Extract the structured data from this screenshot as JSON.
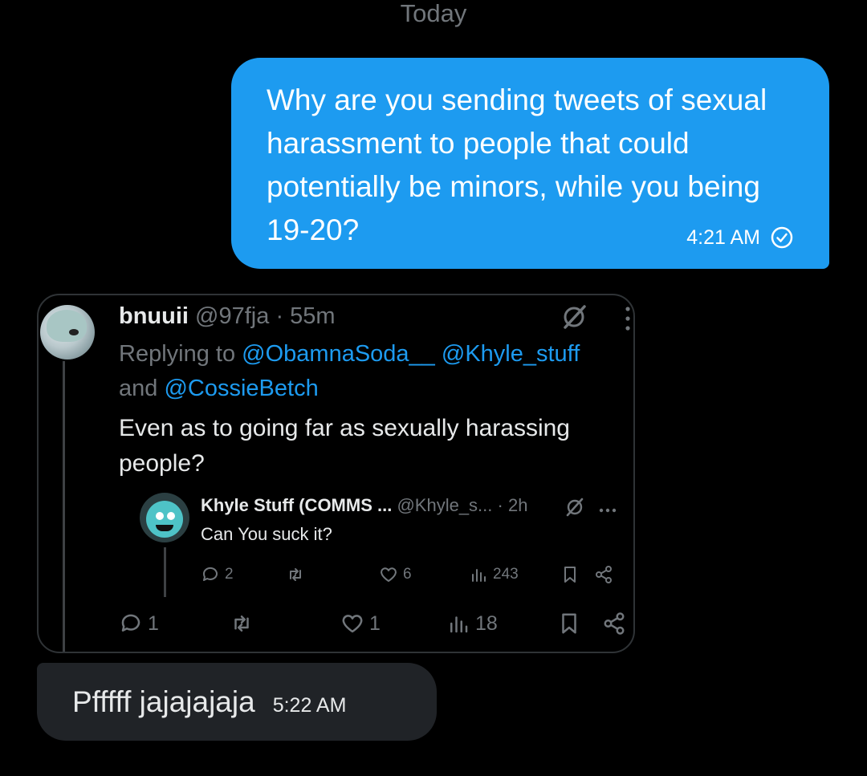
{
  "day_separator": "Today",
  "outgoing_message": {
    "text": "Why are you sending tweets of sexual harassment to people that could potentially be minors, while you being 19-20?",
    "time": "4:21 AM",
    "status_icon": "check-circle-icon"
  },
  "quoted_tweet": {
    "author_name": "bnuuii",
    "author_handle": "@97fja",
    "separator": "·",
    "time": "55m",
    "replying_prefix": "Replying to",
    "mention_1": "@ObamnaSoda__",
    "mention_2": "@Khyle_stuff",
    "and_word": "and",
    "mention_3": "@CossieBetch",
    "text": "Even as to going far as sexually harassing people?",
    "actions": {
      "replies": "1",
      "reposts": "",
      "likes": "1",
      "views": "18"
    },
    "inner_tweet": {
      "author_name": "Khyle Stuff (COMMS ...",
      "author_handle": "@Khyle_s...",
      "separator": "·",
      "time": "2h",
      "text": "Can You suck it?",
      "actions": {
        "replies": "2",
        "reposts": "",
        "likes": "6",
        "views": "243"
      }
    }
  },
  "incoming_message": {
    "text": "Pfffff jajajajaja",
    "time": "5:22 AM"
  },
  "colors": {
    "background": "#000000",
    "outgoing_bubble": "#1d9bf0",
    "incoming_bubble": "#202327",
    "mention": "#1d9bf0",
    "muted": "#71767b"
  }
}
